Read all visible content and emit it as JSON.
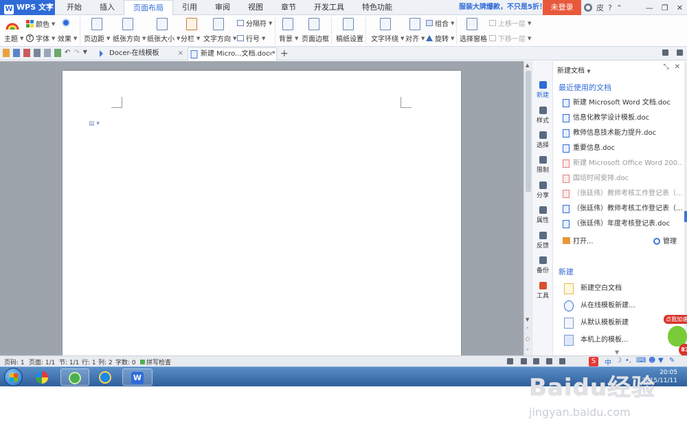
{
  "app": {
    "name": "WPS 文字",
    "menu_tabs": [
      "开始",
      "插入",
      "页面布局",
      "引用",
      "审阅",
      "视图",
      "章节",
      "开发工具",
      "特色功能"
    ],
    "active_tab": "页面布局",
    "promo": "服装大牌爆款，不只是5折！",
    "login": "未登录",
    "title_icons": [
      "皮",
      "?"
    ]
  },
  "ribbon": {
    "theme": "主题",
    "color": "颜色",
    "font": "字体",
    "effect": "效果",
    "margin": "页边距",
    "orientation": "纸张方向",
    "size": "纸张大小",
    "columns": "分栏",
    "text_direction": "文字方向",
    "breaks": "分隔符",
    "line_numbers": "行号",
    "background": "背景",
    "page_border": "页面边框",
    "draft_settings": "稿纸设置",
    "wrap_text": "文字环绕",
    "align": "对齐",
    "rotate": "旋转",
    "group": "组合",
    "selection_pane": "选择窗格",
    "bring_forward": "上移一层",
    "send_backward": "下移一层"
  },
  "doc_tabs": [
    {
      "label": "Docer-在线模板",
      "active": false
    },
    {
      "label": "新建 Micro...文档.doc *",
      "active": true
    }
  ],
  "side_strip": [
    "新建",
    "样式",
    "选择",
    "限制",
    "分享",
    "属性",
    "反馈",
    "备份",
    "工具"
  ],
  "pane": {
    "title": "新建文档",
    "recent_title": "最近使用的文档",
    "recent_items": [
      {
        "name": "新建 Microsoft Word 文档.doc",
        "dim": false
      },
      {
        "name": "信息化教学设计模板.doc",
        "dim": false
      },
      {
        "name": "教师信息技术能力提升.doc",
        "dim": false
      },
      {
        "name": "重要信息.doc",
        "dim": false
      },
      {
        "name": "新建 Microsoft Office Word 200...",
        "dim": true
      },
      {
        "name": "国培时间安排.doc",
        "dim": true
      },
      {
        "name": "（张廷伟）教师考核工作登记表（...",
        "dim": true
      },
      {
        "name": "（张廷伟）教师考核工作登记表（...",
        "dim": false
      },
      {
        "name": "（张廷伟）年度考核登记表.doc",
        "dim": false
      }
    ],
    "open": "打开...",
    "manage": "管理",
    "new_title": "新建",
    "new_items": [
      "新建空白文档",
      "从在线模板新建...",
      "从默认模板新建",
      "本机上的模板..."
    ]
  },
  "ad": {
    "label": "点我加速",
    "count": "83"
  },
  "status": {
    "page_code": "页码: 1",
    "pages": "页面: 1/1",
    "section": "节: 1/1",
    "row": "行: 1",
    "col": "列: 2",
    "words": "字数: 0",
    "spell": "拼写检查"
  },
  "ime": {
    "cn": "中"
  },
  "clock": {
    "time": "20:05",
    "date": "2015/11/11"
  },
  "watermark": {
    "brand": "Baidu经验",
    "url": "jingyan.baidu.com"
  },
  "colors": {
    "accent": "#2f6bd8",
    "login": "#e8593c",
    "workspace": "#9ea4ac"
  }
}
